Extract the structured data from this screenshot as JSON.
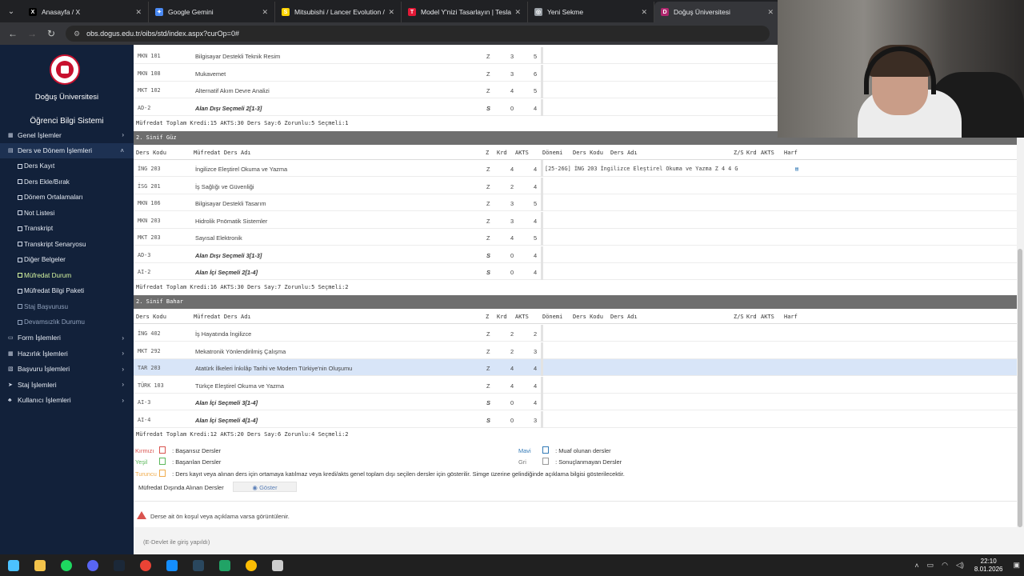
{
  "browser": {
    "tabs": [
      {
        "label": "Anasayfa / X",
        "icon": "x-logo-icon",
        "color": "#000000",
        "glyph": "X",
        "active": false
      },
      {
        "label": "Google Gemini",
        "icon": "gemini-icon",
        "color": "#4a8af4",
        "glyph": "✦",
        "active": false
      },
      {
        "label": "Mitsubishi / Lancer Evolution /",
        "icon": "sahibinden-icon",
        "color": "#ffd400",
        "glyph": "S",
        "active": false
      },
      {
        "label": "Model Y'nizi Tasarlayın | Tesla",
        "icon": "tesla-icon",
        "color": "#e31937",
        "glyph": "T",
        "active": false
      },
      {
        "label": "Yeni Sekme",
        "icon": "chrome-icon",
        "color": "#9aa0a6",
        "glyph": "◎",
        "active": false
      },
      {
        "label": "Doğuş Üniversitesi",
        "icon": "dogus-icon",
        "color": "#b0266e",
        "glyph": "D",
        "active": true
      }
    ],
    "url": "obs.dogus.edu.tr/oibs/std/index.aspx?curOp=0#"
  },
  "sidebar": {
    "university": "Doğuş Üniversitesi",
    "system": "Öğrenci Bilgi Sistemi",
    "items": [
      {
        "label": "Genel İşlemler",
        "icon": "grid-icon",
        "type": "item",
        "chev": "›"
      },
      {
        "label": "Ders ve Dönem İşlemleri",
        "icon": "layers-icon",
        "type": "open",
        "chev": "˄"
      },
      {
        "label": "Ders Kayıt",
        "type": "sub"
      },
      {
        "label": "Ders Ekle/Bırak",
        "type": "sub"
      },
      {
        "label": "Dönem Ortalamaları",
        "type": "sub"
      },
      {
        "label": "Not Listesi",
        "type": "sub"
      },
      {
        "label": "Transkript",
        "type": "sub"
      },
      {
        "label": "Transkript Senaryosu",
        "type": "sub"
      },
      {
        "label": "Diğer Belgeler",
        "type": "sub"
      },
      {
        "label": "Müfredat Durum",
        "type": "sub-active"
      },
      {
        "label": "Müfredat Bilgi Paketi",
        "type": "sub"
      },
      {
        "label": "Staj Başvurusu",
        "type": "sub-dim"
      },
      {
        "label": "Devamsızlık Durumu",
        "type": "sub-dim"
      },
      {
        "label": "Form İşlemleri",
        "icon": "form-icon",
        "type": "item",
        "chev": "›"
      },
      {
        "label": "Hazırlık İşlemleri",
        "icon": "grid-icon",
        "type": "item",
        "chev": "›"
      },
      {
        "label": "Başvuru İşlemleri",
        "icon": "doc-icon",
        "type": "item",
        "chev": "›"
      },
      {
        "label": "Staj İşlemleri",
        "icon": "arrow-icon",
        "type": "item",
        "chev": "›"
      },
      {
        "label": "Kullanıcı İşlemleri",
        "icon": "user-icon",
        "type": "item",
        "chev": "›"
      }
    ]
  },
  "curriculum": {
    "top_rows": [
      {
        "code": "MKN 101",
        "name": "Bilgisayar Destekli Teknik Resim",
        "z": "Z",
        "krd": "3",
        "akts": "5",
        "elective": false
      },
      {
        "code": "MKN 108",
        "name": "Mukavemet",
        "z": "Z",
        "krd": "3",
        "akts": "6",
        "elective": false
      },
      {
        "code": "MKT 102",
        "name": "Alternatif Akım Devre Analizi",
        "z": "Z",
        "krd": "4",
        "akts": "5",
        "elective": false
      },
      {
        "code": "AD-2",
        "name": "Alan Dışı Seçmeli 2[1-3]",
        "z": "S",
        "krd": "0",
        "akts": "4",
        "elective": true
      }
    ],
    "top_summary": "Müfredat Toplam Kredi:15 AKTS:30 Ders Say:6 Zorunlu:5 Seçmeli:1",
    "columns": {
      "code": "Ders Kodu",
      "name": "Müfredat Ders Adı",
      "z": "Z",
      "krd": "Krd",
      "akts": "AKTS",
      "term": "Dönemi",
      "tcode": "Ders Kodu",
      "tname": "Ders Adı",
      "zs": "Z/S",
      "tkrd": "Krd",
      "takts": "AKTS",
      "grade": "Harf"
    },
    "sem3": {
      "title": "2. Sinif  Güz",
      "rows": [
        {
          "code": "İNG 203",
          "name": "İngilizce Eleştirel Okuma ve Yazma",
          "z": "Z",
          "krd": "4",
          "akts": "4",
          "elective": false,
          "taken": "[25-26G] İNG 203   İngilizce Eleştirel Okuma ve Yazma   Z   4   4   G"
        },
        {
          "code": "İSG 201",
          "name": "İş Sağlığı ve Güvenliği",
          "z": "Z",
          "krd": "2",
          "akts": "4",
          "elective": false,
          "taken": ""
        },
        {
          "code": "MKN 106",
          "name": "Bilgisayar Destekli Tasarım",
          "z": "Z",
          "krd": "3",
          "akts": "5",
          "elective": false,
          "taken": ""
        },
        {
          "code": "MKN 203",
          "name": "Hidrolik Pnömatik Sistemler",
          "z": "Z",
          "krd": "3",
          "akts": "4",
          "elective": false,
          "taken": ""
        },
        {
          "code": "MKT 203",
          "name": "Sayısal Elektronik",
          "z": "Z",
          "krd": "4",
          "akts": "5",
          "elective": false,
          "taken": ""
        },
        {
          "code": "AD-3",
          "name": "Alan Dışı Seçmeli 3[1-3]",
          "z": "S",
          "krd": "0",
          "akts": "4",
          "elective": true,
          "taken": ""
        },
        {
          "code": "AI-2",
          "name": "Alan İçi Seçmeli 2[1-4]",
          "z": "S",
          "krd": "0",
          "akts": "4",
          "elective": true,
          "taken": ""
        }
      ],
      "summary": "Müfredat Toplam Kredi:16 AKTS:30 Ders Say:7 Zorunlu:5 Seçmeli:2"
    },
    "sem4": {
      "title": "2. Sinif  Bahar",
      "rows": [
        {
          "code": "İNG 402",
          "name": "İş Hayatında İngilizce",
          "z": "Z",
          "krd": "2",
          "akts": "2",
          "elective": false,
          "taken": ""
        },
        {
          "code": "MKT 292",
          "name": "Mekatronik Yönlendirilmiş Çalışma",
          "z": "Z",
          "krd": "2",
          "akts": "3",
          "elective": false,
          "taken": ""
        },
        {
          "code": "TAR 203",
          "name": "Atatürk İlkeleri İnkılâp Tarihi ve Modern Türkiye'nin Oluşumu",
          "z": "Z",
          "krd": "4",
          "akts": "4",
          "elective": false,
          "taken": ""
        },
        {
          "code": "TÜRK 103",
          "name": "Türkçe Eleştirel Okuma ve Yazma",
          "z": "Z",
          "krd": "4",
          "akts": "4",
          "elective": false,
          "taken": ""
        },
        {
          "code": "AI-3",
          "name": "Alan İçi Seçmeli 3[1-4]",
          "z": "S",
          "krd": "0",
          "akts": "4",
          "elective": true,
          "taken": ""
        },
        {
          "code": "AI-4",
          "name": "Alan İçi Seçmeli 4[1-4]",
          "z": "S",
          "krd": "0",
          "akts": "3",
          "elective": true,
          "taken": ""
        }
      ],
      "summary": "Müfredat Toplam Kredi:12 AKTS:20 Ders Say:6 Zorunlu:4 Seçmeli:2"
    }
  },
  "legend": {
    "red_name": "Kırmızı",
    "red_desc": ": Başarısız Dersler",
    "red_color": "#d9534f",
    "green_name": "Yeşil",
    "green_desc": ": Başarılan Dersler",
    "green_color": "#5cb85c",
    "orange_name": "Turuncu",
    "orange_desc": ": Ders kayıt veya alınan ders için ortamaya katılmaz veya kredi/akts genel toplam dışı seçilen dersler için gösterilir. Simge üzerine gelindiğinde açıklama bilgisi gösterilecektir.",
    "orange_color": "#f0ad4e",
    "blue_name": "Mavi",
    "blue_desc": ": Muaf olunan dersler",
    "blue_color": "#337ab7",
    "gray_name": "Gri",
    "gray_desc": ": Sonuçlanmayan Dersler",
    "gray_color": "#999999"
  },
  "extra": {
    "label": "Müfredat Dışında Alınan Dersler",
    "button": "Göster"
  },
  "warning": "Derse ait ön koşul veya açıklama varsa görüntülenir.",
  "footer": "(E-Devlet ile giriş yapıldı)",
  "taskbar": {
    "apps": [
      {
        "name": "windows-start-icon",
        "color": "#4cc2ff"
      },
      {
        "name": "file-explorer-icon",
        "color": "#f3c34a"
      },
      {
        "name": "spotify-icon",
        "color": "#1ed760"
      },
      {
        "name": "discord-icon",
        "color": "#5865f2"
      },
      {
        "name": "steam-icon",
        "color": "#1b2838"
      },
      {
        "name": "chrome-icon",
        "color": "#ea4335"
      },
      {
        "name": "battlenet-icon",
        "color": "#148eff"
      },
      {
        "name": "steam2-icon",
        "color": "#2a475e"
      },
      {
        "name": "app-icon",
        "color": "#21a366"
      },
      {
        "name": "chrome-active-icon",
        "color": "#fbbc04"
      },
      {
        "name": "app2-icon",
        "color": "#cccccc"
      }
    ],
    "time": "22:10",
    "date": "8.01.2026"
  }
}
